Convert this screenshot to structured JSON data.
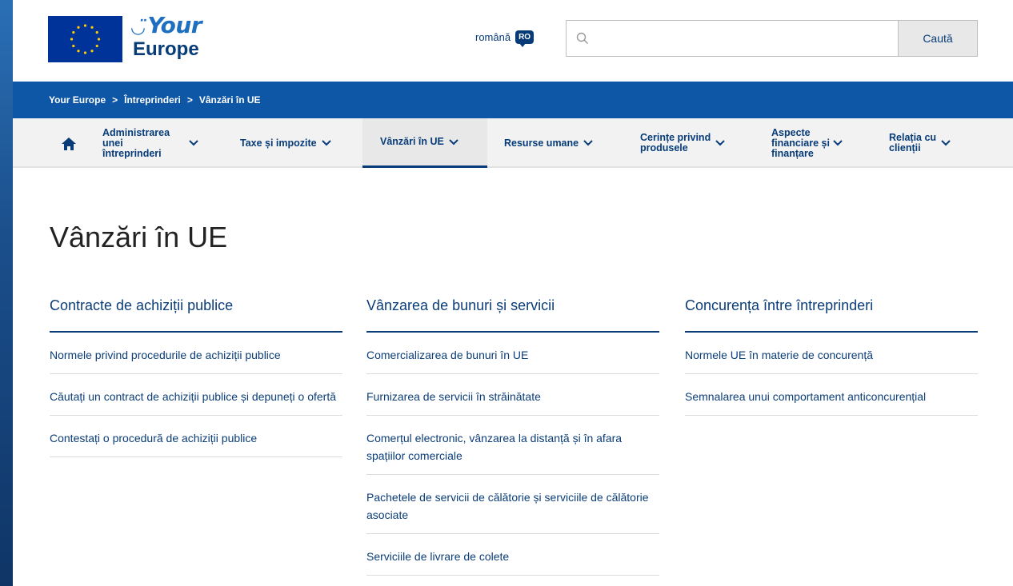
{
  "brand": {
    "your": "Your",
    "europe": "Europe"
  },
  "language": {
    "label": "română",
    "code": "RO"
  },
  "search": {
    "placeholder": "",
    "button": "Caută"
  },
  "breadcrumb": [
    "Your Europe",
    "Întreprinderi",
    "Vânzări în UE"
  ],
  "breadcrumb_separator": ">",
  "nav": [
    {
      "label": "Administrarea unei întreprinderi",
      "lines": [
        "Administrarea",
        "unei",
        "întreprinderi"
      ]
    },
    {
      "label": "Taxe și impozite",
      "lines": [
        "Taxe și impozite"
      ]
    },
    {
      "label": "Vânzări în UE",
      "lines": [
        "Vânzări în UE"
      ],
      "active": true
    },
    {
      "label": "Resurse umane",
      "lines": [
        "Resurse umane"
      ]
    },
    {
      "label": "Cerințe privind produsele",
      "lines": [
        "Cerințe privind",
        "produsele"
      ]
    },
    {
      "label": "Aspecte financiare și finanțare",
      "lines": [
        "Aspecte",
        "financiare și",
        "finanțare"
      ]
    },
    {
      "label": "Relația cu clienții",
      "lines": [
        "Relația cu",
        "clienții"
      ]
    }
  ],
  "page_title": "Vânzări în UE",
  "columns": [
    {
      "heading": "Contracte de achiziții publice",
      "links": [
        "Normele privind procedurile de achiziții publice",
        "Căutați un contract de achiziții publice și depuneți o ofertă",
        "Contestați o procedură de achiziții publice"
      ]
    },
    {
      "heading": "Vânzarea de bunuri și servicii",
      "links": [
        "Comercializarea de bunuri în UE",
        "Furnizarea de servicii în străinătate",
        "Comerțul electronic, vânzarea la distanță și în afara spațiilor comerciale",
        "Pachetele de servicii de călătorie și serviciile de călătorie asociate",
        "Serviciile de livrare de colete"
      ]
    },
    {
      "heading": "Concurența între întreprinderi",
      "links": [
        "Normele UE în materie de concurență",
        "Semnalarea unui comportament anticoncurențial"
      ]
    }
  ],
  "colors": {
    "primary": "#073c79",
    "accent": "#0e57a6",
    "eu_flag": "#003399"
  },
  "icons": {
    "home": "home-icon",
    "search": "search-icon",
    "chevron": "chevron-down-icon"
  }
}
